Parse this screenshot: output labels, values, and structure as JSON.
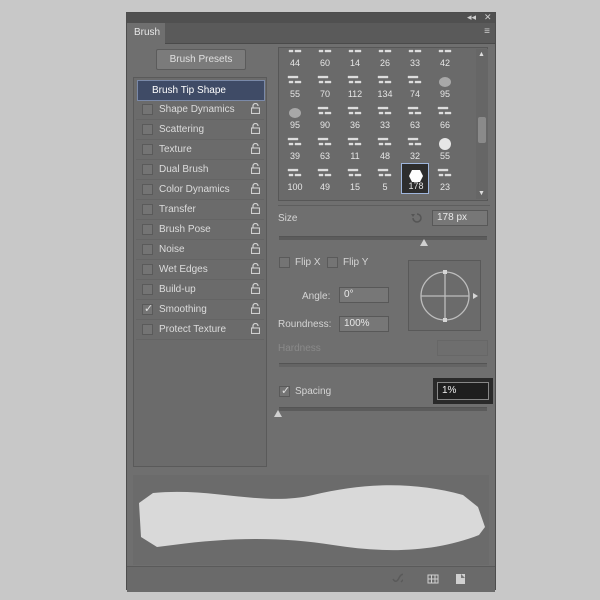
{
  "panel": {
    "tab_label": "Brush",
    "collapse_glyph": "◂◂",
    "close_glyph": "✕",
    "menu_glyph": "≡"
  },
  "presets_button": "Brush Presets",
  "options": [
    {
      "label": "Brush Tip Shape",
      "selected": true
    },
    {
      "label": "Shape Dynamics",
      "checked": false,
      "locked": true
    },
    {
      "label": "Scattering",
      "checked": false,
      "locked": true
    },
    {
      "label": "Texture",
      "checked": false,
      "locked": true
    },
    {
      "label": "Dual Brush",
      "checked": false,
      "locked": true
    },
    {
      "label": "Color Dynamics",
      "checked": false,
      "locked": true
    },
    {
      "label": "Transfer",
      "checked": false,
      "locked": true
    },
    {
      "label": "Brush Pose",
      "checked": false,
      "locked": true
    },
    {
      "label": "Noise",
      "checked": false,
      "locked": true
    },
    {
      "label": "Wet Edges",
      "checked": false,
      "locked": true
    },
    {
      "label": "Build-up",
      "checked": false,
      "locked": true
    },
    {
      "label": "Smoothing",
      "checked": true,
      "locked": true
    },
    {
      "label": "Protect Texture",
      "checked": false,
      "locked": true
    }
  ],
  "tips": [
    [
      "44",
      "60",
      "14",
      "26",
      "33",
      "42"
    ],
    [
      "55",
      "70",
      "112",
      "134",
      "74",
      "95"
    ],
    [
      "95",
      "90",
      "36",
      "33",
      "63",
      "66"
    ],
    [
      "39",
      "63",
      "11",
      "48",
      "32",
      "55"
    ],
    [
      "100",
      "49",
      "15",
      "5",
      "178",
      "23"
    ]
  ],
  "size": {
    "label": "Size",
    "value": "178 px",
    "slider": 0.6
  },
  "flip_x": {
    "label": "Flip X",
    "checked": false
  },
  "flip_y": {
    "label": "Flip Y",
    "checked": false
  },
  "angle": {
    "label": "Angle:",
    "value": "0°"
  },
  "roundness": {
    "label": "Roundness:",
    "value": "100%"
  },
  "hardness": {
    "label": "Hardness",
    "value": ""
  },
  "spacing": {
    "label": "Spacing",
    "checked": true,
    "value": "1%",
    "slider": 0.01
  },
  "icons": {
    "reset": "reset-icon",
    "lock": "lock-icon",
    "brush_toggle": "brush-toggle-icon",
    "grid": "grid-icon",
    "new": "new-preset-icon"
  },
  "colors": {
    "selection": "#3f4b66",
    "preview_stroke": "#d9d9d9"
  }
}
